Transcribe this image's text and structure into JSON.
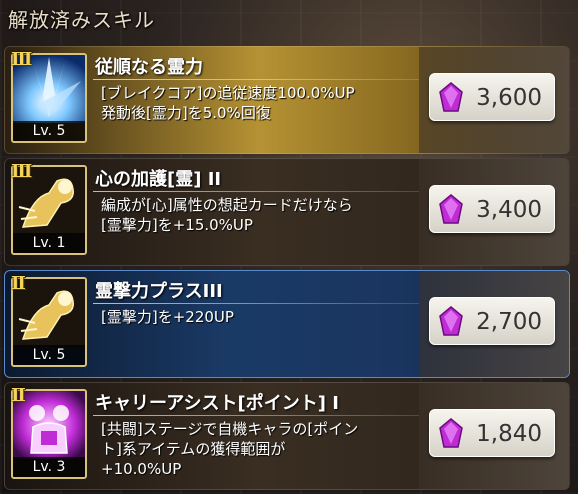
{
  "header": {
    "title": "解放済みスキル"
  },
  "skills": [
    {
      "rank": "III",
      "title": "従順なる霊力",
      "level": "Lv. 5",
      "desc_lines": [
        "[ブレイクコア]の追従速度100.0%UP",
        "発動後[霊力]を5.0%回復"
      ],
      "cost": "3,600",
      "icon": "burst-icon",
      "style": "gold"
    },
    {
      "rank": "III",
      "title": "心の加護[霊] II",
      "level": "Lv. 1",
      "desc_lines": [
        "編成が[心]属性の想起カードだけなら",
        "[霊撃力]を+15.0%UP"
      ],
      "cost": "3,400",
      "icon": "fist-icon",
      "style": "dark"
    },
    {
      "rank": "II",
      "title": "霊撃力プラスIII",
      "level": "Lv. 5",
      "desc_lines": [
        "[霊撃力]を+220UP"
      ],
      "cost": "2,700",
      "icon": "fist-icon",
      "style": "blue"
    },
    {
      "rank": "II",
      "title": "キャリーアシスト[ポイント] I",
      "level": "Lv. 3",
      "desc_lines": [
        "[共闘]ステージで自機キャラの[ポイン",
        "ト]系アイテムの獲得範囲が",
        "+10.0%UP"
      ],
      "cost": "1,840",
      "icon": "assist-icon",
      "style": "dark"
    }
  ],
  "colors": {
    "gem": "#c02bd6",
    "rank": "#f4d35a",
    "frame": "#d9c27a"
  }
}
